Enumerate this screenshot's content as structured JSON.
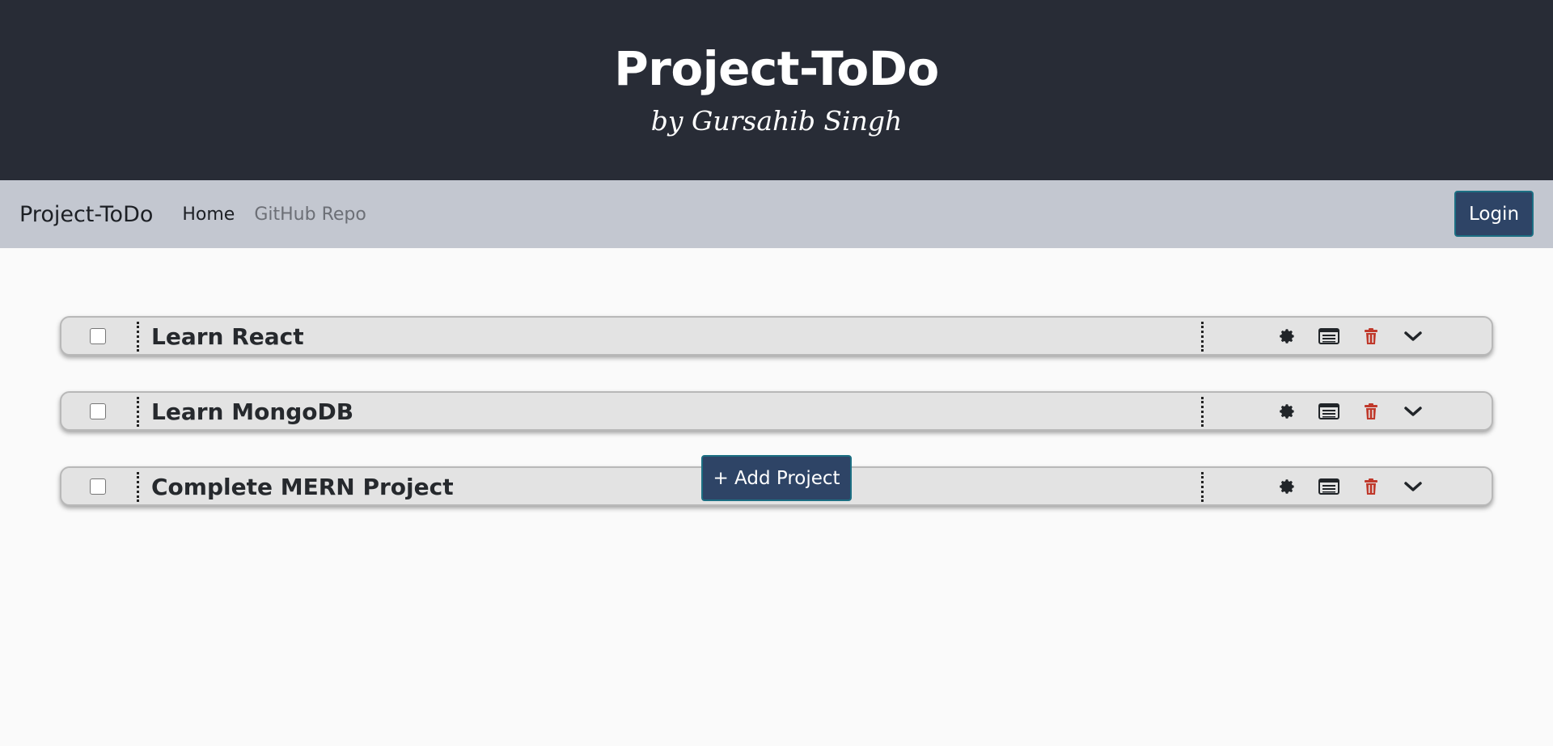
{
  "header": {
    "title": "Project-ToDo",
    "subtitle": "by Gursahib Singh"
  },
  "navbar": {
    "brand": "Project-ToDo",
    "links": [
      {
        "label": "Home",
        "state": "active"
      },
      {
        "label": "GitHub Repo",
        "state": "muted"
      }
    ],
    "login_label": "Login"
  },
  "projects": [
    {
      "name": "Learn React",
      "checked": false
    },
    {
      "name": "Learn MongoDB",
      "checked": false
    },
    {
      "name": "Complete MERN Project",
      "checked": false
    }
  ],
  "project_actions": [
    {
      "icon": "gear-icon",
      "color": "#212529"
    },
    {
      "icon": "list-icon",
      "color": "#212529"
    },
    {
      "icon": "trash-icon",
      "color": "#c0392b"
    },
    {
      "icon": "chevron-down-icon",
      "color": "#212529"
    }
  ],
  "add_project_label": "+ Add Project",
  "colors": {
    "header_bg": "#282c36",
    "navbar_bg": "#c3c7d0",
    "button_bg": "#2e4466",
    "danger": "#c0392b"
  }
}
